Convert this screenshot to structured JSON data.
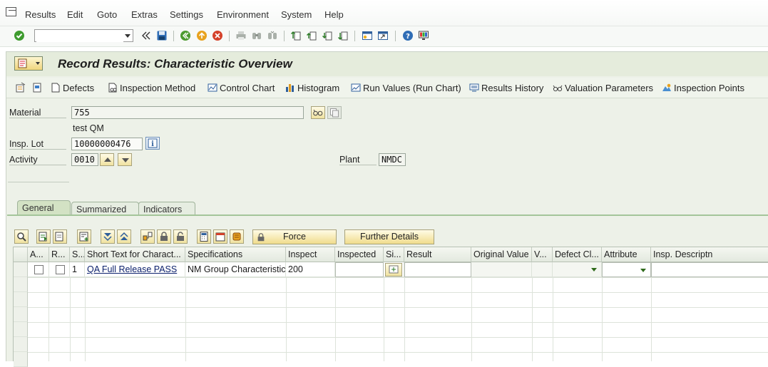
{
  "menu": {
    "items": [
      "Results",
      "Edit",
      "Goto",
      "Extras",
      "Settings",
      "Environment",
      "System",
      "Help"
    ]
  },
  "toolbar": {
    "command_value": "",
    "icons": [
      "enter-icon",
      "back-double-icon",
      "save-icon",
      "back-icon",
      "exit-icon",
      "cancel-icon",
      "print-icon",
      "find-icon",
      "find-next-icon",
      "first-page-icon",
      "previous-page-icon",
      "next-page-icon",
      "last-page-icon",
      "create-session-icon",
      "shortcut-icon",
      "help-icon",
      "customize-layout-icon"
    ]
  },
  "title": "Record Results: Characteristic Overview",
  "app_toolbar": {
    "defects": "Defects",
    "inspection_method": "Inspection Method",
    "control_chart": "Control Chart",
    "histogram": "Histogram",
    "run_values": "Run Values (Run Chart)",
    "results_history": "Results History",
    "valuation_parameters": "Valuation Parameters",
    "inspection_points": "Inspection Points"
  },
  "header": {
    "material_label": "Material",
    "material_value": "755",
    "material_text": "test QM",
    "insp_lot_label": "Insp. Lot",
    "insp_lot_value": "10000000476",
    "activity_label": "Activity",
    "activity_value": "0010",
    "plant_label": "Plant",
    "plant_value": "NMDC"
  },
  "tabs": [
    "General",
    "Summarized",
    "Indicators"
  ],
  "grid_toolbar": {
    "force_label": "Force",
    "further_details_label": "Further Details"
  },
  "table": {
    "columns": [
      "A...",
      "R...",
      "S...",
      "Short Text for Charact...",
      "Specifications",
      "Inspect",
      "Inspected",
      "Si...",
      "Result",
      "Original Value",
      "V...",
      "Defect Cl...",
      "Attribute",
      "Insp. Descriptn"
    ],
    "rows": [
      {
        "seq": "1",
        "short_text": "QA Full Release PASS",
        "specifications": "NM Group Characteristic ...",
        "inspect": "200",
        "inspected": "",
        "result": "",
        "original_value": ""
      }
    ]
  },
  "colors": {
    "background": "#edf1e8",
    "button_gold": "#f0dc8c",
    "tab_active": "#d3e2c4"
  }
}
